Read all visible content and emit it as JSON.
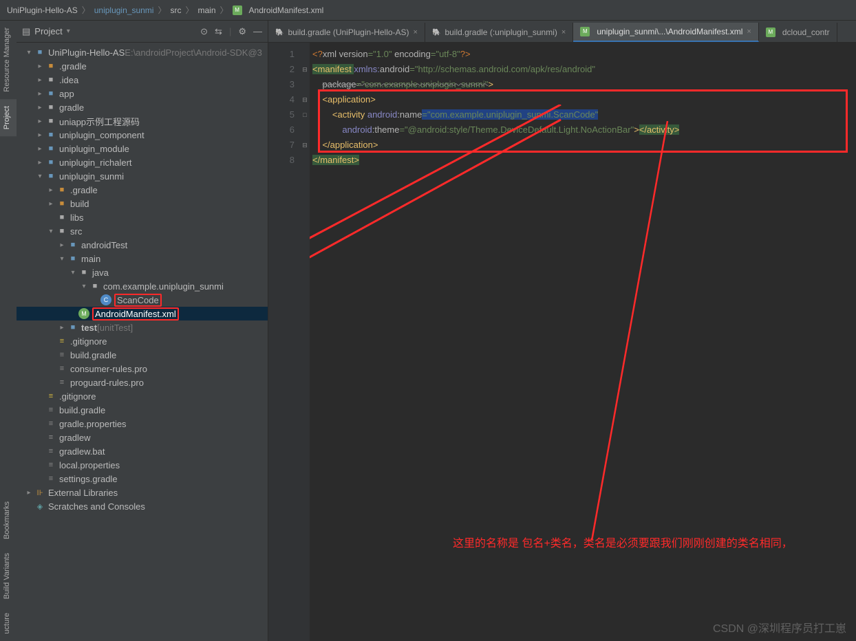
{
  "breadcrumbs": [
    "UniPlugin-Hello-AS",
    "uniplugin_sunmi",
    "src",
    "main",
    "AndroidManifest.xml"
  ],
  "panel": {
    "title": "Project"
  },
  "side_tabs": [
    "Resource Manager",
    "Project",
    "Bookmarks",
    "Build Variants",
    "ucture"
  ],
  "tree": [
    {
      "d": 0,
      "e": "▾",
      "i": "module",
      "t": "UniPlugin-Hello-AS",
      "suffix": "  E:\\androidProject\\Android-SDK@3"
    },
    {
      "d": 1,
      "e": "▸",
      "i": "folder-o",
      "t": ".gradle"
    },
    {
      "d": 1,
      "e": "▸",
      "i": "folder",
      "t": ".idea"
    },
    {
      "d": 1,
      "e": "▸",
      "i": "module",
      "t": "app"
    },
    {
      "d": 1,
      "e": "▸",
      "i": "folder",
      "t": "gradle"
    },
    {
      "d": 1,
      "e": "▸",
      "i": "folder",
      "t": "uniapp示例工程源码"
    },
    {
      "d": 1,
      "e": "▸",
      "i": "module",
      "t": "uniplugin_component"
    },
    {
      "d": 1,
      "e": "▸",
      "i": "module",
      "t": "uniplugin_module"
    },
    {
      "d": 1,
      "e": "▸",
      "i": "module",
      "t": "uniplugin_richalert"
    },
    {
      "d": 1,
      "e": "▾",
      "i": "module",
      "t": "uniplugin_sunmi"
    },
    {
      "d": 2,
      "e": "▸",
      "i": "folder-o",
      "t": ".gradle"
    },
    {
      "d": 2,
      "e": "▸",
      "i": "folder-o",
      "t": "build"
    },
    {
      "d": 2,
      "e": " ",
      "i": "folder",
      "t": "libs"
    },
    {
      "d": 2,
      "e": "▾",
      "i": "folder",
      "t": "src"
    },
    {
      "d": 3,
      "e": "▸",
      "i": "module",
      "t": "androidTest"
    },
    {
      "d": 3,
      "e": "▾",
      "i": "module",
      "t": "main"
    },
    {
      "d": 4,
      "e": "▾",
      "i": "folder",
      "t": "java"
    },
    {
      "d": 5,
      "e": "▾",
      "i": "folder",
      "t": "com.example.uniplugin_sunmi"
    },
    {
      "d": 6,
      "e": " ",
      "i": "class",
      "t": "ScanCode",
      "boxed": true
    },
    {
      "d": 4,
      "e": " ",
      "i": "xml",
      "t": "AndroidManifest.xml",
      "boxed": true,
      "selected": true
    },
    {
      "d": 3,
      "e": "▸",
      "i": "module",
      "t": "test",
      "suffix": " [unitTest]",
      "bold": true
    },
    {
      "d": 2,
      "e": " ",
      "i": "file-y",
      "t": ".gitignore"
    },
    {
      "d": 2,
      "e": " ",
      "i": "file-g",
      "t": "build.gradle"
    },
    {
      "d": 2,
      "e": " ",
      "i": "file-g",
      "t": "consumer-rules.pro"
    },
    {
      "d": 2,
      "e": " ",
      "i": "file-g",
      "t": "proguard-rules.pro"
    },
    {
      "d": 1,
      "e": " ",
      "i": "file-y",
      "t": ".gitignore"
    },
    {
      "d": 1,
      "e": " ",
      "i": "file-g",
      "t": "build.gradle"
    },
    {
      "d": 1,
      "e": " ",
      "i": "file-g",
      "t": "gradle.properties"
    },
    {
      "d": 1,
      "e": " ",
      "i": "file-g",
      "t": "gradlew"
    },
    {
      "d": 1,
      "e": " ",
      "i": "file-g",
      "t": "gradlew.bat"
    },
    {
      "d": 1,
      "e": " ",
      "i": "file-g",
      "t": "local.properties"
    },
    {
      "d": 1,
      "e": " ",
      "i": "file-g",
      "t": "settings.gradle"
    },
    {
      "d": 0,
      "e": "▸",
      "i": "lib",
      "t": "External Libraries"
    },
    {
      "d": 0,
      "e": " ",
      "i": "scratch",
      "t": "Scratches and Consoles"
    }
  ],
  "tabs": [
    {
      "label": "build.gradle (UniPlugin-Hello-AS)",
      "active": false,
      "close": true
    },
    {
      "label": "build.gradle (:uniplugin_sunmi)",
      "active": false,
      "close": true
    },
    {
      "label": "uniplugin_sunmi\\...\\AndroidManifest.xml",
      "active": true,
      "close": true,
      "xml": true
    },
    {
      "label": "dcloud_contr",
      "active": false,
      "close": false,
      "xml": true
    }
  ],
  "code": {
    "lines": [
      "1",
      "2",
      "3",
      "4",
      "5",
      "6",
      "7",
      "8"
    ],
    "l1": {
      "a": "<?",
      "b": "xml version",
      "c": "=\"1.0\"",
      "d": " encoding",
      "e": "=\"utf-8\"",
      "f": "?>"
    },
    "l2": {
      "a": "<manifest ",
      "b": "xmlns:",
      "c": "android",
      "d": "=\"http://schemas.android.com/apk/res/android\""
    },
    "l3": {
      "a": "package",
      "b": "=\"com.example.uniplugin_sunmi\"",
      "c": ">"
    },
    "l4": {
      "a": "<application>"
    },
    "l5": {
      "a": "<activity ",
      "b": "android",
      "c": ":name",
      "d": "=\"com.example.uniplugin_sunmi.ScanCode\""
    },
    "l6": {
      "a": "android",
      "b": ":theme",
      "c": "=\"@android:style/Theme.DeviceDefault.Light.NoActionBar\"",
      "d": ">",
      "e": "</activity>"
    },
    "l7": {
      "a": "</application>"
    },
    "l8": {
      "a": "</manifest>"
    }
  },
  "annotation_text": "这里的名称是 包名+类名，类名是必须要跟我们刚刚创建的类名相同，",
  "watermark": "CSDN @深圳程序员打工崽"
}
